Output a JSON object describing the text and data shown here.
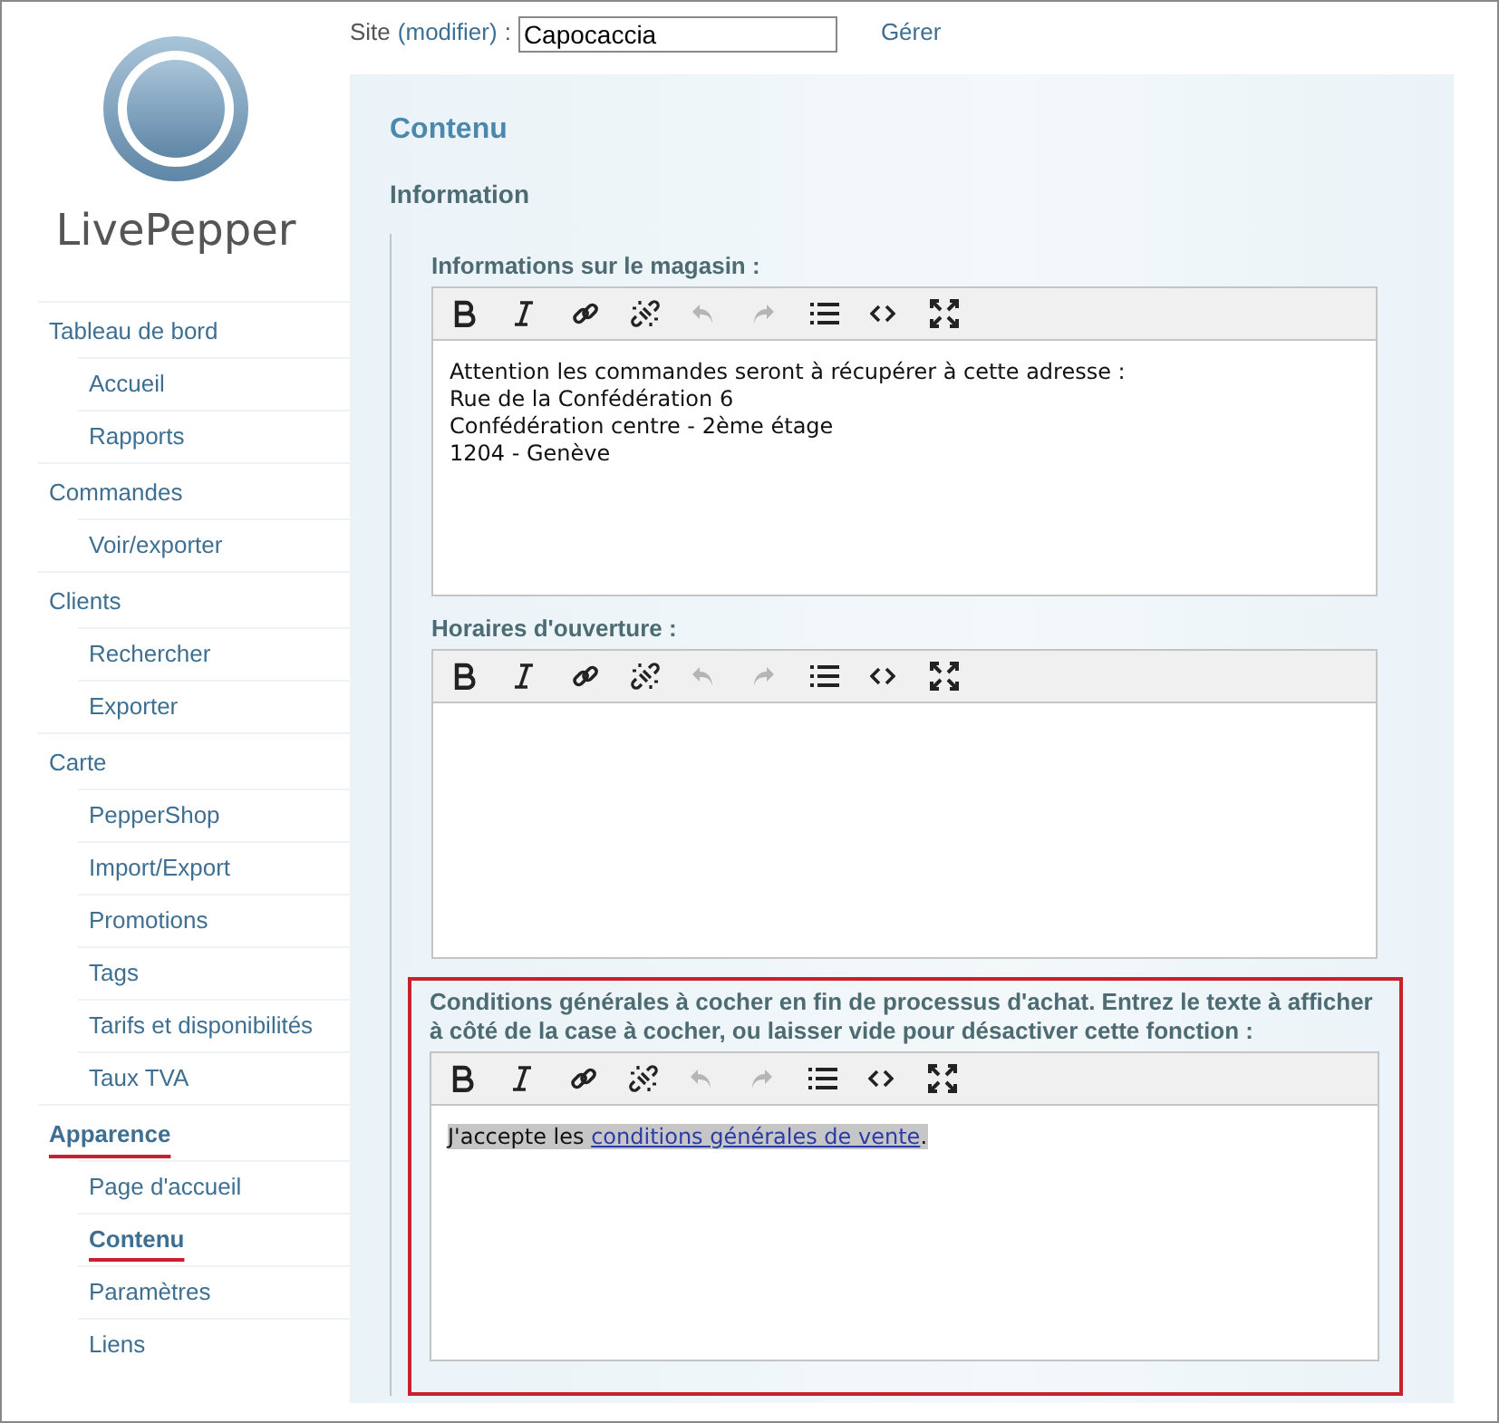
{
  "logo": {
    "text": "LivePepper"
  },
  "site_bar": {
    "label": "Site",
    "link": "(modifier)",
    "colon": ":",
    "value": "Capocaccia",
    "manage_link": "Gérer"
  },
  "sidebar": {
    "groups": [
      {
        "label": "Tableau de bord",
        "selected": false,
        "items": [
          {
            "label": "Accueil",
            "selected": false
          },
          {
            "label": "Rapports",
            "selected": false
          }
        ]
      },
      {
        "label": "Commandes",
        "selected": false,
        "items": [
          {
            "label": "Voir/exporter",
            "selected": false
          }
        ]
      },
      {
        "label": "Clients",
        "selected": false,
        "items": [
          {
            "label": "Rechercher",
            "selected": false
          },
          {
            "label": "Exporter",
            "selected": false
          }
        ]
      },
      {
        "label": "Carte",
        "selected": false,
        "items": [
          {
            "label": "PepperShop",
            "selected": false
          },
          {
            "label": "Import/Export",
            "selected": false
          },
          {
            "label": "Promotions",
            "selected": false
          },
          {
            "label": "Tags",
            "selected": false
          },
          {
            "label": "Tarifs et disponibilités",
            "selected": false
          },
          {
            "label": "Taux TVA",
            "selected": false
          }
        ]
      },
      {
        "label": "Apparence",
        "selected": true,
        "items": [
          {
            "label": "Page d'accueil",
            "selected": false
          },
          {
            "label": "Contenu",
            "selected": true
          },
          {
            "label": "Paramètres",
            "selected": false
          },
          {
            "label": "Liens",
            "selected": false
          }
        ]
      }
    ]
  },
  "page": {
    "title": "Contenu",
    "section": "Information"
  },
  "editors": [
    {
      "label": "Informations sur le magasin :",
      "highlighted": false,
      "toolbar": [
        {
          "kind": "bold",
          "disabled": false
        },
        {
          "kind": "italic",
          "disabled": false
        },
        {
          "kind": "link",
          "disabled": false
        },
        {
          "kind": "unlink",
          "disabled": false
        },
        {
          "kind": "undo",
          "disabled": true
        },
        {
          "kind": "redo",
          "disabled": true
        },
        {
          "kind": "list",
          "disabled": false
        },
        {
          "kind": "code",
          "disabled": false
        },
        {
          "kind": "fullscreen",
          "disabled": false
        }
      ],
      "lines": [
        [
          {
            "text": "Attention les commandes seront à récupérer à cette adresse :",
            "link": false
          }
        ],
        [
          {
            "text": "Rue de la Confédération 6",
            "link": false
          }
        ],
        [
          {
            "text": "Confédération centre - 2ème étage",
            "link": false
          }
        ],
        [
          {
            "text": "1204 - Genève",
            "link": false
          }
        ]
      ]
    },
    {
      "label": "Horaires d'ouverture :",
      "highlighted": false,
      "toolbar": [
        {
          "kind": "bold",
          "disabled": false
        },
        {
          "kind": "italic",
          "disabled": false
        },
        {
          "kind": "link",
          "disabled": false
        },
        {
          "kind": "unlink",
          "disabled": false
        },
        {
          "kind": "undo",
          "disabled": true
        },
        {
          "kind": "redo",
          "disabled": true
        },
        {
          "kind": "list",
          "disabled": false
        },
        {
          "kind": "code",
          "disabled": false
        },
        {
          "kind": "fullscreen",
          "disabled": false
        }
      ]
    },
    {
      "label": "Conditions générales à cocher en fin de processus d'achat. Entrez le texte à afficher à côté de la case à cocher, ou laisser vide pour désactiver cette fonction :",
      "highlighted": true,
      "text_selected": true,
      "toolbar": [
        {
          "kind": "bold",
          "disabled": false
        },
        {
          "kind": "italic",
          "disabled": false
        },
        {
          "kind": "link",
          "disabled": false
        },
        {
          "kind": "unlink",
          "disabled": false
        },
        {
          "kind": "undo",
          "disabled": true
        },
        {
          "kind": "redo",
          "disabled": true
        },
        {
          "kind": "list",
          "disabled": false
        },
        {
          "kind": "code",
          "disabled": false
        },
        {
          "kind": "fullscreen",
          "disabled": false
        }
      ],
      "lines": [
        [
          {
            "text": "J'accepte les ",
            "link": false
          },
          {
            "text": "conditions générales de vente",
            "link": true
          },
          {
            "text": ".",
            "link": false
          }
        ]
      ]
    }
  ]
}
